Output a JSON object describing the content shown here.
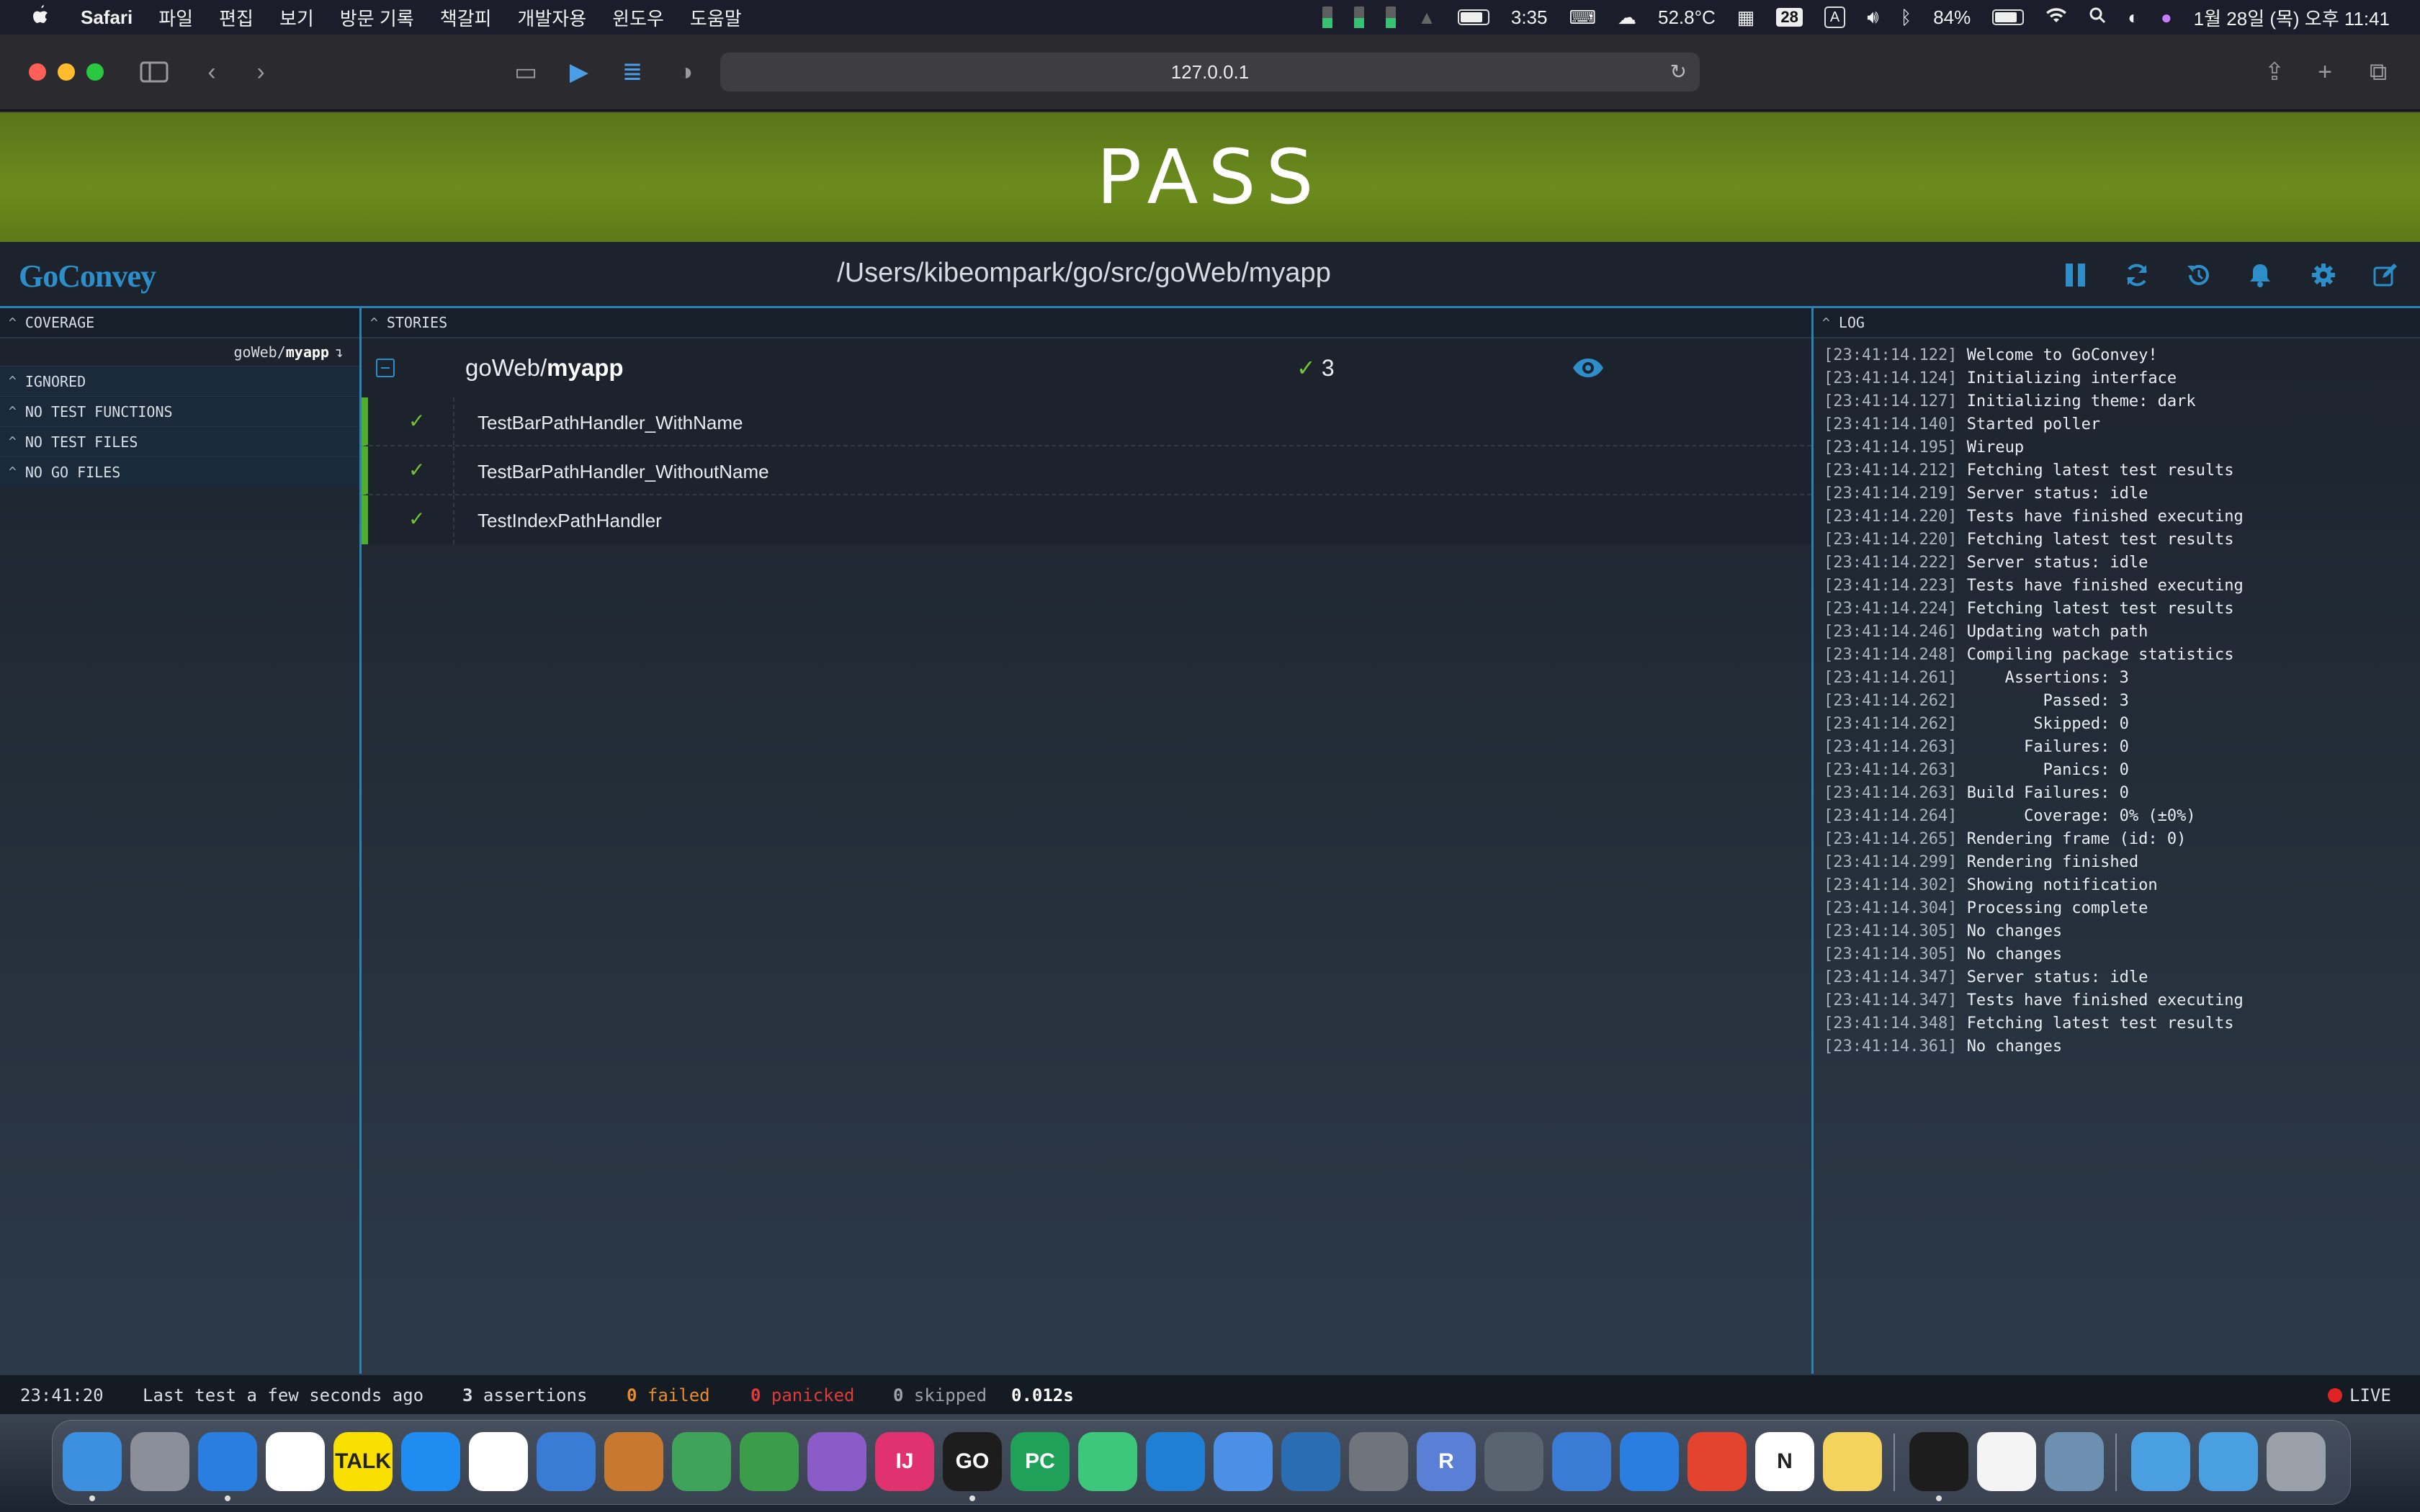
{
  "menubar": {
    "app_name": "Safari",
    "menus": [
      "파일",
      "편집",
      "보기",
      "방문 기록",
      "책갈피",
      "개발자용",
      "윈도우",
      "도움말"
    ],
    "clock_time": "3:35",
    "temperature": "52.8°C",
    "calendar_badge": "28",
    "input_badge": "A",
    "battery_percent": "84%",
    "datetime": "1월 28일 (목) 오후 11:41"
  },
  "browser": {
    "url": "127.0.0.1"
  },
  "banner": {
    "status": "PASS",
    "color": "#6b8c1d"
  },
  "header": {
    "logo": "GoConvey",
    "path": "/Users/kibeompark/go/src/goWeb/myapp",
    "controls": [
      "pause-icon",
      "refresh-icon",
      "history-icon",
      "bell-icon",
      "gear-icon",
      "edit-icon"
    ]
  },
  "coverage": {
    "title": "COVERAGE",
    "package_prefix": "goWeb/",
    "package_name": "myapp",
    "sections": [
      "IGNORED",
      "NO TEST FUNCTIONS",
      "NO TEST FILES",
      "NO GO FILES"
    ]
  },
  "stories": {
    "title": "STORIES",
    "package_prefix": "goWeb/",
    "package_name": "myapp",
    "pass_count": "3",
    "tests": [
      "TestBarPathHandler_WithName",
      "TestBarPathHandler_WithoutName",
      "TestIndexPathHandler"
    ]
  },
  "log": {
    "title": "LOG",
    "lines": [
      {
        "ts": "[23:41:14.122]",
        "msg": "Welcome to GoConvey!"
      },
      {
        "ts": "[23:41:14.124]",
        "msg": "Initializing interface"
      },
      {
        "ts": "[23:41:14.127]",
        "msg": "Initializing theme: dark"
      },
      {
        "ts": "[23:41:14.140]",
        "msg": "Started poller"
      },
      {
        "ts": "[23:41:14.195]",
        "msg": "Wireup"
      },
      {
        "ts": "[23:41:14.212]",
        "msg": "Fetching latest test results"
      },
      {
        "ts": "[23:41:14.219]",
        "msg": "Server status: idle"
      },
      {
        "ts": "[23:41:14.220]",
        "msg": "Tests have finished executing"
      },
      {
        "ts": "[23:41:14.220]",
        "msg": "Fetching latest test results"
      },
      {
        "ts": "[23:41:14.222]",
        "msg": "Server status: idle"
      },
      {
        "ts": "[23:41:14.223]",
        "msg": "Tests have finished executing"
      },
      {
        "ts": "[23:41:14.224]",
        "msg": "Fetching latest test results"
      },
      {
        "ts": "[23:41:14.246]",
        "msg": "Updating watch path"
      },
      {
        "ts": "[23:41:14.248]",
        "msg": "Compiling package statistics"
      },
      {
        "ts": "[23:41:14.261]",
        "msg": "    Assertions: 3"
      },
      {
        "ts": "[23:41:14.262]",
        "msg": "        Passed: 3"
      },
      {
        "ts": "[23:41:14.262]",
        "msg": "       Skipped: 0"
      },
      {
        "ts": "[23:41:14.263]",
        "msg": "      Failures: 0"
      },
      {
        "ts": "[23:41:14.263]",
        "msg": "        Panics: 0"
      },
      {
        "ts": "[23:41:14.263]",
        "msg": "Build Failures: 0"
      },
      {
        "ts": "[23:41:14.264]",
        "msg": "      Coverage: 0% (±0%)"
      },
      {
        "ts": "[23:41:14.265]",
        "msg": "Rendering frame (id: 0)"
      },
      {
        "ts": "[23:41:14.299]",
        "msg": "Rendering finished"
      },
      {
        "ts": "[23:41:14.302]",
        "msg": "Showing notification"
      },
      {
        "ts": "[23:41:14.304]",
        "msg": "Processing complete"
      },
      {
        "ts": "[23:41:14.305]",
        "msg": "No changes"
      },
      {
        "ts": "[23:41:14.305]",
        "msg": "No changes"
      },
      {
        "ts": "[23:41:14.347]",
        "msg": "Server status: idle"
      },
      {
        "ts": "[23:41:14.347]",
        "msg": "Tests have finished executing"
      },
      {
        "ts": "[23:41:14.348]",
        "msg": "Fetching latest test results"
      },
      {
        "ts": "[23:41:14.361]",
        "msg": "No changes"
      }
    ]
  },
  "footer": {
    "time": "23:41:20",
    "last_test": "Last test a few seconds ago",
    "assertions_count": "3",
    "assertions_label": "assertions",
    "failed_count": "0",
    "failed_label": "failed",
    "panicked_count": "0",
    "panicked_label": "panicked",
    "skipped_count": "0",
    "skipped_label": "skipped",
    "duration": "0.012s",
    "live_label": "LIVE",
    "colors": {
      "failed": "#e88a2d",
      "panicked": "#e03b3b",
      "skipped": "#9aa3ad"
    }
  },
  "dock": {
    "icons": [
      "finder-icon",
      "launchpad-icon",
      "safari-icon",
      "chrome-icon",
      "kakaotalk-icon",
      "app-store-icon",
      "radar-icon",
      "word-icon",
      "tortoise-icon",
      "atom-icon",
      "sourcetree-icon",
      "github-icon",
      "intellij-icon",
      "goland-icon",
      "pycharm-icon",
      "android-studio-icon",
      "vscode-icon",
      "xcode-icon",
      "settings-wheel-icon",
      "system-preferences-icon",
      "r-icon",
      "flask-icon",
      "paper-plane-icon",
      "apple-app-icon",
      "todoist-icon",
      "notion-icon",
      "stickies-icon",
      "terminal-icon",
      "textedit-icon",
      "preview-icon",
      "folder-icon",
      "downloads-folder-icon",
      "trash-icon"
    ],
    "labels": {
      "kakaotalk-icon": "TALK",
      "intellij-icon": "IJ",
      "goland-icon": "GO",
      "pycharm-icon": "PC",
      "r-icon": "R",
      "notion-icon": "N"
    }
  }
}
